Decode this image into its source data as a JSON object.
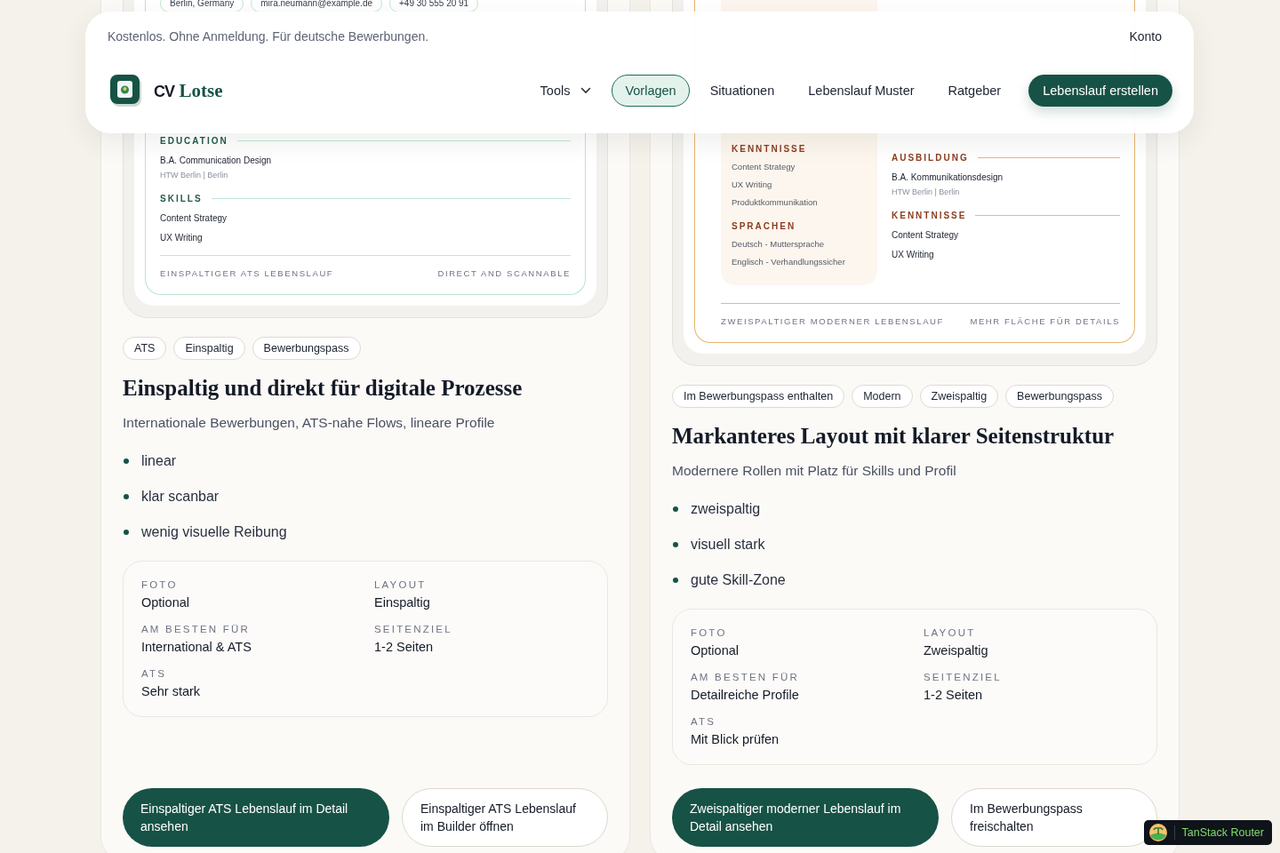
{
  "header": {
    "tagline": "Kostenlos. Ohne Anmeldung. Für deutsche Bewerbungen.",
    "account_link": "Konto",
    "brand": {
      "prefix": "CV",
      "name": "Lotse"
    },
    "nav": [
      {
        "label": "Tools",
        "kind": "dropdown",
        "selected": false
      },
      {
        "label": "Vorlagen",
        "kind": "link",
        "selected": true
      },
      {
        "label": "Situationen",
        "kind": "link",
        "selected": false
      },
      {
        "label": "Lebenslauf Muster",
        "kind": "link",
        "selected": false
      },
      {
        "label": "Ratgeber",
        "kind": "link",
        "selected": false
      }
    ],
    "cta": "Lebenslauf erstellen"
  },
  "templates": [
    {
      "preview": {
        "kind": "single",
        "contacts": [
          "Berlin, Germany",
          "mira.neumann@example.de",
          "+49 30 555 20 91"
        ],
        "sections": [
          {
            "heading": "EDUCATION",
            "entries": [
              {
                "title": "B.A. Communication Design",
                "meta": "HTW Berlin | Berlin"
              }
            ]
          },
          {
            "heading": "SKILLS",
            "items": [
              "Content Strategy",
              "UX Writing"
            ]
          }
        ],
        "footer_left": "EINSPALTIGER ATS LEBENSLAUF",
        "footer_right": "DIRECT AND SCANNABLE"
      },
      "tags": [
        "ATS",
        "Einspaltig",
        "Bewerbungspass"
      ],
      "title": "Einspaltig und direkt für digitale Prozesse",
      "subtitle": "Internationale Bewerbungen, ATS-nahe Flows, lineare Profile",
      "bullets": [
        "linear",
        "klar scanbar",
        "wenig visuelle Reibung"
      ],
      "facts": [
        {
          "label": "FOTO",
          "value": "Optional"
        },
        {
          "label": "LAYOUT",
          "value": "Einspaltig"
        },
        {
          "label": "AM BESTEN FÜR",
          "value": "International & ATS"
        },
        {
          "label": "SEITENZIEL",
          "value": "1-2 Seiten"
        },
        {
          "label": "ATS",
          "value": "Sehr stark"
        }
      ],
      "actions": [
        {
          "label": "Einspaltiger ATS Lebenslauf im Detail ansehen",
          "kind": "primary"
        },
        {
          "label": "Einspaltiger ATS Lebenslauf im Builder öffnen",
          "kind": "secondary"
        }
      ]
    },
    {
      "preview": {
        "kind": "two_column",
        "sidebar": [
          {
            "heading": "KENNTNISSE",
            "items": [
              "Content Strategy",
              "UX Writing",
              "Produktkommunikation"
            ]
          },
          {
            "heading": "SPRACHEN",
            "items": [
              "Deutsch - Muttersprache",
              "Englisch - Verhandlungssicher"
            ]
          }
        ],
        "sections": [
          {
            "heading": "AUSBILDUNG",
            "entries": [
              {
                "title": "B.A. Kommunikationsdesign",
                "meta": "HTW Berlin | Berlin"
              }
            ]
          },
          {
            "heading": "KENNTNISSE",
            "items": [
              "Content Strategy",
              "UX Writing"
            ]
          }
        ],
        "footer_left": "ZWEISPALTIGER MODERNER LEBENSLAUF",
        "footer_right": "MEHR FLÄCHE FÜR DETAILS"
      },
      "tags": [
        "Im Bewerbungspass enthalten",
        "Modern",
        "Zweispaltig",
        "Bewerbungspass"
      ],
      "title": "Markanteres Layout mit klarer Seitenstruktur",
      "subtitle": "Modernere Rollen mit Platz für Skills und Profil",
      "bullets": [
        "zweispaltig",
        "visuell stark",
        "gute Skill-Zone"
      ],
      "facts": [
        {
          "label": "FOTO",
          "value": "Optional"
        },
        {
          "label": "LAYOUT",
          "value": "Zweispaltig"
        },
        {
          "label": "AM BESTEN FÜR",
          "value": "Detailreiche Profile"
        },
        {
          "label": "SEITENZIEL",
          "value": "1-2 Seiten"
        },
        {
          "label": "ATS",
          "value": "Mit Blick prüfen"
        }
      ],
      "actions": [
        {
          "label": "Zweispaltiger moderner Lebenslauf im Detail ansehen",
          "kind": "primary"
        },
        {
          "label": "Im Bewerbungspass freischalten",
          "kind": "secondary"
        }
      ]
    }
  ],
  "devtools_badge": "TanStack Router"
}
